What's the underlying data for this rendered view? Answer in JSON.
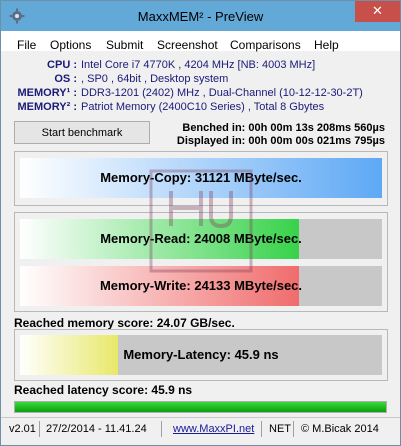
{
  "window": {
    "title": "MaxxMEM² - PreView",
    "close_glyph": "✕",
    "icon": "gear-icon"
  },
  "menu": [
    "File",
    "Options",
    "Submit",
    "Screenshot",
    "Comparisons",
    "Help"
  ],
  "info": [
    {
      "key": "CPU :",
      "value": "Intel Core i7 4770K , 4204 MHz [NB: 4003 MHz]"
    },
    {
      "key": "OS :",
      "value": ", SP0 , 64bit , Desktop system"
    },
    {
      "key": "MEMORY¹ :",
      "value": "DDR3-1201 (2402) MHz , Dual-Channel (10-12-12-30-2T)"
    },
    {
      "key": "MEMORY² :",
      "value": "Patriot Memory (2400C10 Series) , Total 8 Gbytes"
    }
  ],
  "benchmark": {
    "button_label": "Start benchmark",
    "benched": "Benched in: 00h 00m 13s 208ms 560µs",
    "displayed": "Displayed in: 00h 00m 00s 021ms 795µs"
  },
  "copy": {
    "label": "Memory-Copy: 31121 MByte/sec.",
    "fill": 1.0,
    "color": "#5ea8f5"
  },
  "read": {
    "label": "Memory-Read: 24008 MByte/sec.",
    "fill": 0.77,
    "color": "#37d24a"
  },
  "write": {
    "label": "Memory-Write: 24133 MByte/sec.",
    "fill": 0.77,
    "color": "#f06c6c"
  },
  "memory_score": "Reached memory score: 24.07 GB/sec.",
  "latency": {
    "label": "Memory-Latency: 45.9 ns",
    "fill": 0.27,
    "color": "#e8e86a"
  },
  "latency_score": "Reached latency score: 45.9 ns",
  "progress": 1.0,
  "status": {
    "version": "v2.01",
    "datetime": "27/2/2014 - 11.41.24",
    "url": "www.MaxxPI.net",
    "net": "NET",
    "copyright": "© M.Bicak 2014"
  }
}
